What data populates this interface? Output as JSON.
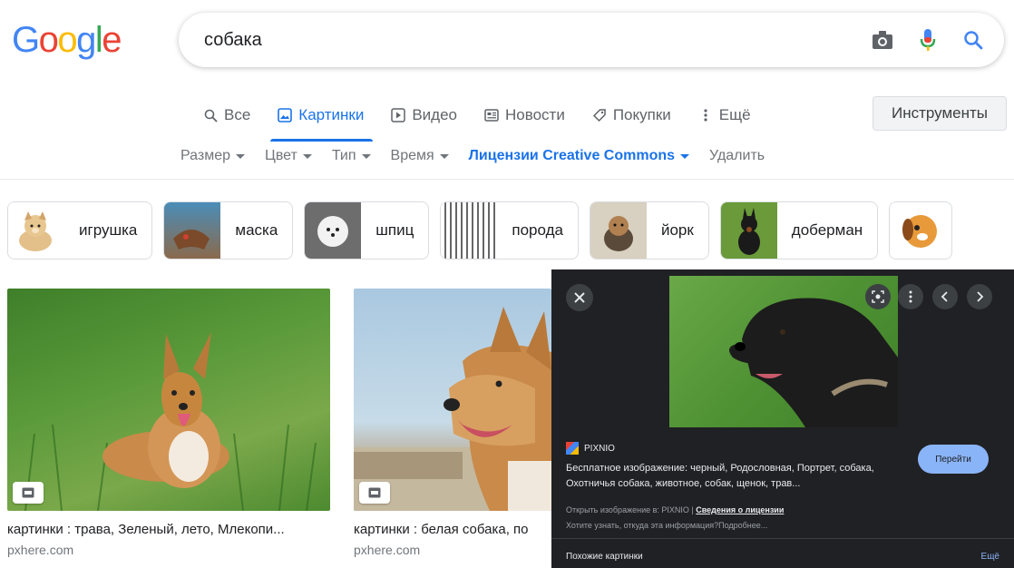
{
  "logo": {
    "letters": [
      "G",
      "o",
      "o",
      "g",
      "l",
      "e"
    ],
    "colors": [
      "#4285f4",
      "#ea4335",
      "#fbbc05",
      "#4285f4",
      "#34a853",
      "#ea4335"
    ]
  },
  "search": {
    "query": "собака",
    "icons": [
      "camera-icon",
      "microphone-icon",
      "search-icon"
    ]
  },
  "tabs": [
    {
      "label": "Все",
      "icon": "search-icon",
      "active": false
    },
    {
      "label": "Картинки",
      "icon": "image-icon",
      "active": true
    },
    {
      "label": "Видео",
      "icon": "play-icon",
      "active": false
    },
    {
      "label": "Новости",
      "icon": "news-icon",
      "active": false
    },
    {
      "label": "Покупки",
      "icon": "tag-icon",
      "active": false
    },
    {
      "label": "Ещё",
      "icon": "more-vert-icon",
      "active": false
    }
  ],
  "tools_label": "Инструменты",
  "filters": [
    {
      "label": "Размер"
    },
    {
      "label": "Цвет"
    },
    {
      "label": "Тип"
    },
    {
      "label": "Время"
    },
    {
      "label": "Лицензии Creative Commons"
    },
    {
      "label": "Удалить"
    }
  ],
  "chips": [
    {
      "label": "игрушка"
    },
    {
      "label": "маска"
    },
    {
      "label": "шпиц"
    },
    {
      "label": "порода"
    },
    {
      "label": "йорк"
    },
    {
      "label": "доберман"
    }
  ],
  "results": [
    {
      "title": "картинки : трава, Зеленый, лето, Млекопи...",
      "source": "pxhere.com"
    },
    {
      "title": "картинки : белая собака, по",
      "source": "pxhere.com"
    }
  ],
  "panel": {
    "source": "PIXNIO",
    "visit_label": "Перейти",
    "description": "Бесплатное изображение: черный, Родословная, Портрет, собака, Охотничья собака, животное, собак, щенок, трав...",
    "open_text": "Открыть изображение в: PIXNIO |",
    "license_link": "Сведения о лицензии",
    "info_text": "Хотите узнать, откуда эта информация?Подробнее...",
    "similar_label": "Похожие картинки",
    "more_label": "Ещё"
  },
  "colors": {
    "accent": "#1a73e8",
    "panel_bg": "#202124",
    "button": "#8ab4f8"
  }
}
